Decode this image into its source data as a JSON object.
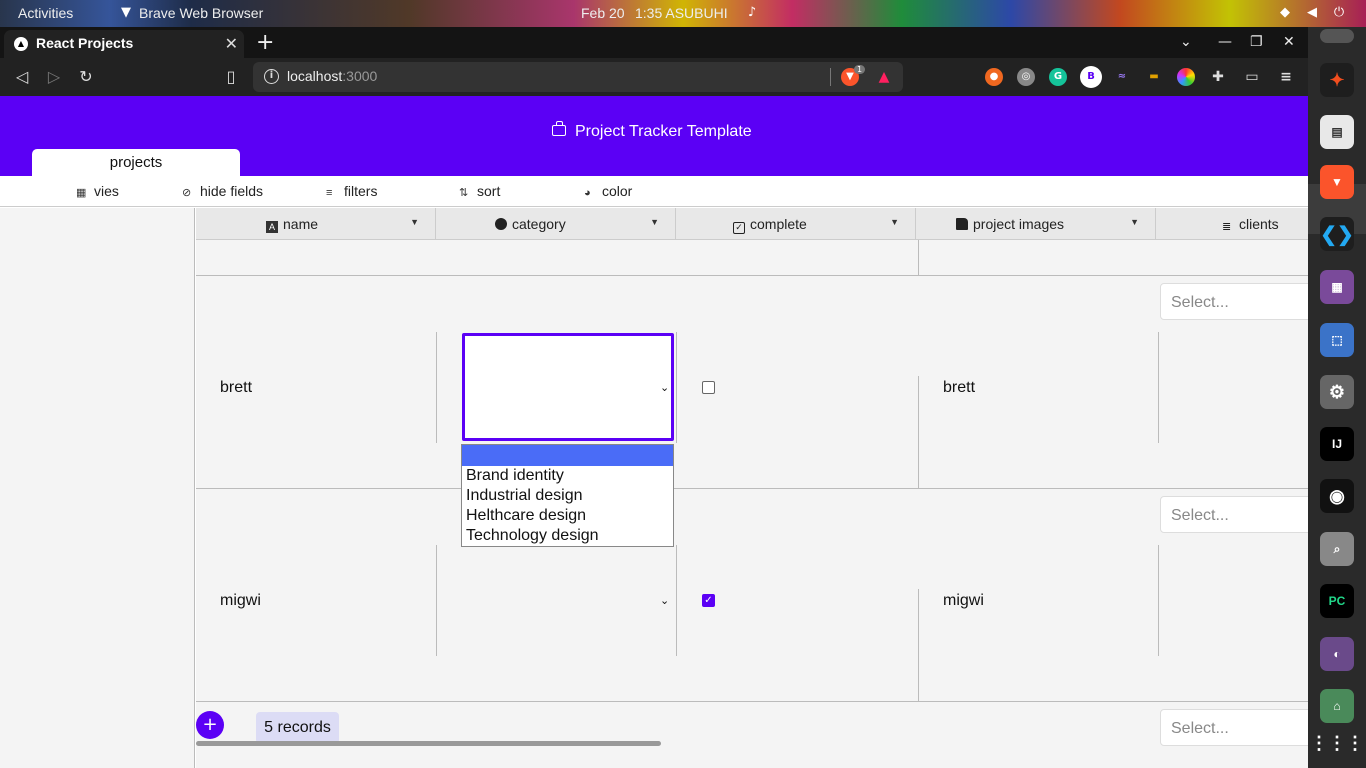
{
  "system": {
    "activities": "Activities",
    "app_name": "Brave Web Browser",
    "date": "Feb 20",
    "time": "1:35 ASUBUHI"
  },
  "browser": {
    "tab_title": "React Projects",
    "url_host": "localhost",
    "url_port": ":3000",
    "brave_badge": "1",
    "profile_initial": "B"
  },
  "app": {
    "title": "Project Tracker Template",
    "active_table_tab": "projects",
    "view_bar": {
      "views": "vies",
      "hide_fields": "hide fields",
      "filters": "filters",
      "sort": "sort",
      "color": "color"
    },
    "columns": [
      "name",
      "category",
      "complete",
      "project images",
      "clients"
    ],
    "rows": [
      {
        "name": "brett",
        "category": "",
        "complete": false,
        "project_images": "brett",
        "clients_placeholder": "Select..."
      },
      {
        "name": "migwi",
        "category": "",
        "complete": true,
        "project_images": "migwi",
        "clients_placeholder": "Select..."
      }
    ],
    "extra_clients_placeholder": "Select...",
    "category_options": [
      "",
      "Brand identity",
      "Industrial design",
      "Helthcare design",
      "Technology design"
    ],
    "records_label": "5 records",
    "add_label": "+"
  },
  "colors": {
    "brand": "#5b00f5",
    "option_highlight": "#4a6cf7"
  }
}
